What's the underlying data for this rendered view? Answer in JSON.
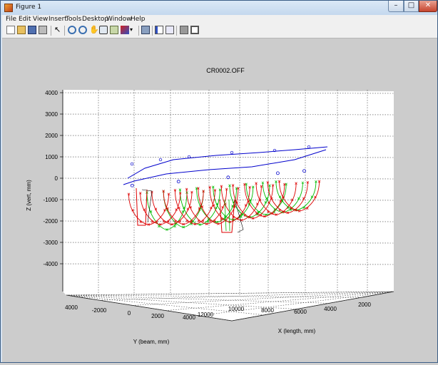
{
  "window": {
    "title": "Figure 1",
    "minimize_glyph": "–",
    "maximize_glyph": "□",
    "close_glyph": "✕"
  },
  "menu": [
    "File",
    "Edit",
    "View",
    "Insert",
    "Tools",
    "Desktop",
    "Window",
    "Help"
  ],
  "toolbar_icons": [
    "new-figure-icon",
    "open-file-icon",
    "save-icon",
    "print-icon",
    "edit-plot-icon",
    "zoom-in-icon",
    "zoom-out-icon",
    "pan-icon",
    "rotate-3d-icon",
    "data-cursor-icon",
    "brush-icon",
    "link-plot-icon",
    "insert-colorbar-icon",
    "insert-legend-icon",
    "hide-plot-tools-icon",
    "show-plot-tools-icon"
  ],
  "colors": {
    "series_red": "#dd0000",
    "series_green": "#00bb00",
    "series_blue": "#0000cc",
    "figure_bg": "#cccccc",
    "axes_bg": "#ffffff"
  },
  "chart_data": {
    "type": "line",
    "projection": "3d",
    "title": "CR0002.OFF",
    "xlabel": "X (length, mm)",
    "ylabel": "Y (beam, mm)",
    "zlabel": "Z (vert, mm)",
    "x_ticks": [
      "12000",
      "10000",
      "8000",
      "6000",
      "4000",
      "2000"
    ],
    "y_ticks": [
      "4000",
      "-2000",
      "0",
      "2000",
      "4000"
    ],
    "z_ticks": [
      "4000",
      "3000",
      "2000",
      "1000",
      "0",
      "-1000",
      "-2000",
      "-3000",
      "-4000"
    ],
    "xlim": [
      1000,
      12500
    ],
    "ylim": [
      -4200,
      4200
    ],
    "zlim": [
      -4000,
      4000
    ],
    "grid": true,
    "series": [
      {
        "color": "#dd0000",
        "marker": "x",
        "stations_x": [
          10800,
          10100,
          9400,
          8700,
          8000,
          7300,
          6600,
          5900,
          5200,
          4500,
          3800,
          3100,
          2400,
          1700
        ]
      },
      {
        "color": "#00bb00",
        "marker": "x",
        "stations_x": [
          9700,
          8700,
          7700,
          6700,
          5700,
          4700,
          3700,
          2700,
          1900
        ]
      },
      {
        "color": "#0000cc",
        "marker": "o",
        "stations_x": [
          11800,
          9000,
          6000,
          3000,
          1400
        ]
      }
    ]
  }
}
